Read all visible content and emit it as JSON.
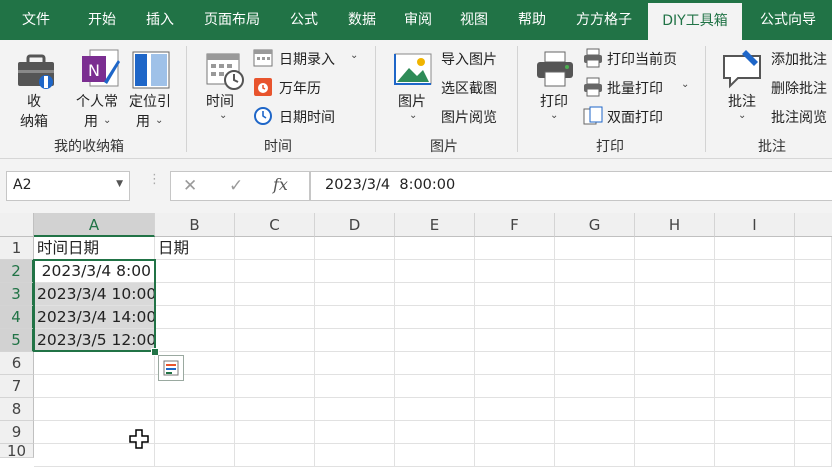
{
  "tabs": [
    "文件",
    "开始",
    "插入",
    "页面布局",
    "公式",
    "数据",
    "审阅",
    "视图",
    "帮助",
    "方方格子",
    "DIY工具箱",
    "公式向导"
  ],
  "active_tab": "DIY工具箱",
  "ribbon": {
    "group1": {
      "btn_storage_l1": "收",
      "btn_storage_l2": "纳箱",
      "btn_personal_l1": "个人常",
      "btn_personal_l2": "用",
      "btn_locate_l1": "定位引",
      "btn_locate_l2": "用",
      "label": "我的收纳箱"
    },
    "group2": {
      "btn_time": "时间",
      "date_entry": "日期录入",
      "calendar": "万年历",
      "date_time": "日期时间",
      "label": "时间"
    },
    "group3": {
      "btn_picture": "图片",
      "import_picture": "导入图片",
      "region_capture": "选区截图",
      "picture_browse": "图片阅览",
      "label": "图片"
    },
    "group4": {
      "btn_print": "打印",
      "print_current": "打印当前页",
      "batch_print": "批量打印",
      "duplex_print": "双面打印",
      "label": "打印"
    },
    "group5": {
      "btn_comment": "批注",
      "add_comment": "添加批注",
      "delete_comment": "删除批注",
      "browse_comment": "批注阅览",
      "label": "批注"
    }
  },
  "formula_bar": {
    "name_box": "A2",
    "cancel": "✕",
    "enter": "✓",
    "fx": "fx",
    "formula": "2023/3/4  8:00:00"
  },
  "columns": [
    "A",
    "B",
    "C",
    "D",
    "E",
    "F",
    "G",
    "H",
    "I"
  ],
  "rows": [
    "1",
    "2",
    "3",
    "4",
    "5",
    "6",
    "7",
    "8",
    "9",
    "10"
  ],
  "cells": {
    "A1": "时间日期",
    "B1": "日期",
    "A2": "2023/3/4 8:00",
    "A3": "2023/3/4 10:00",
    "A4": "2023/3/4 14:00",
    "A5": "2023/3/5 12:00"
  },
  "colors": {
    "excel_green": "#217346",
    "selection": "#d9d9d9"
  },
  "icons": [
    "storage-box-icon",
    "onenote-icon",
    "locate-reference-icon",
    "clock-calendar-icon",
    "date-entry-icon",
    "perpetual-calendar-icon",
    "clock-icon",
    "picture-icon",
    "import-picture-icon",
    "capture-icon",
    "browse-picture-icon",
    "printer-icon",
    "print-page-icon",
    "batch-print-icon",
    "duplex-print-icon",
    "comment-icon",
    "quick-analysis-icon",
    "move-cursor-icon"
  ]
}
